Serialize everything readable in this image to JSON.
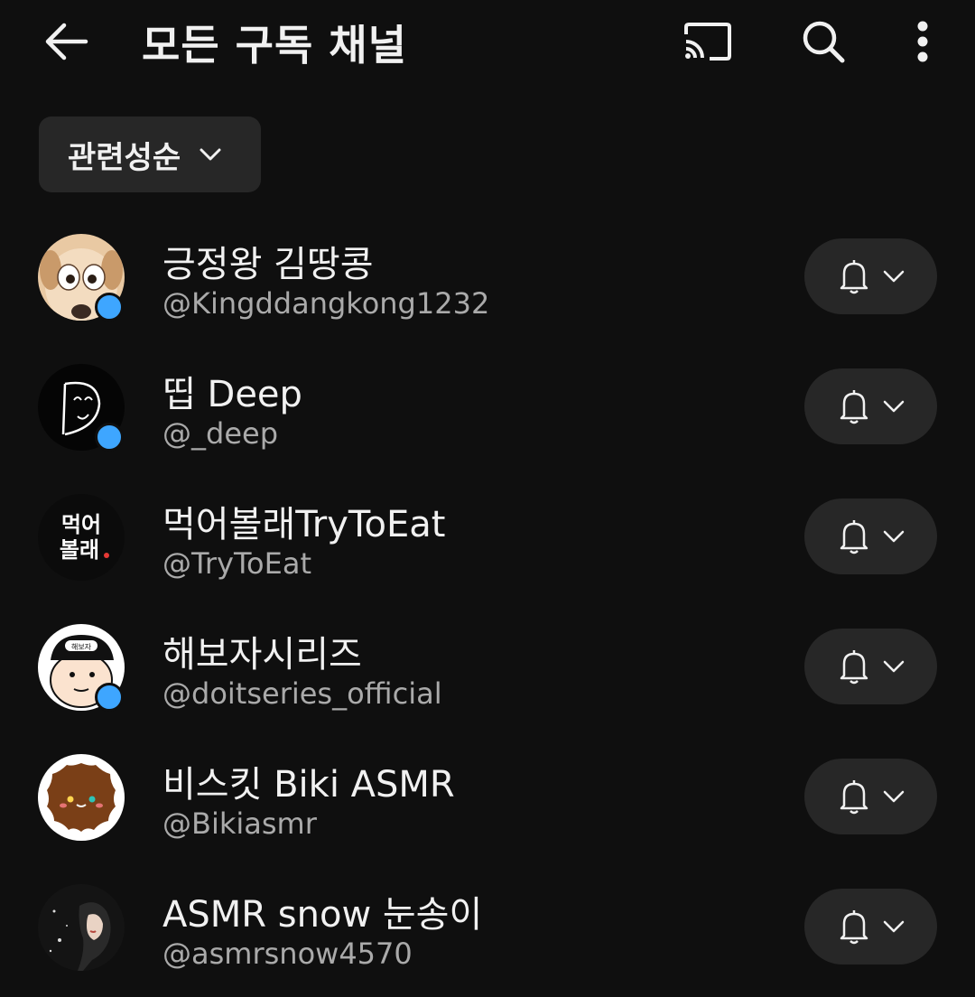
{
  "header": {
    "title": "모든 구독 채널",
    "icons": [
      "back-arrow-icon",
      "cast-icon",
      "search-icon",
      "more-vertical-icon"
    ]
  },
  "sort": {
    "label": "관련성순"
  },
  "colors": {
    "background": "#0f0f0f",
    "surface": "#272727",
    "accent": "#3ea6ff",
    "secondary_text": "#aaaaaa"
  },
  "channels": [
    {
      "name": "긍정왕 김땅콩",
      "handle": "@Kingddangkong1232",
      "new_content": true
    },
    {
      "name": "띱 Deep",
      "handle": "@_deep",
      "new_content": true
    },
    {
      "name": "먹어볼래TryToEat",
      "handle": "@TryToEat",
      "new_content": false,
      "avatar_text": [
        "먹어",
        "볼래"
      ]
    },
    {
      "name": "해보자시리즈",
      "handle": "@doitseries_official",
      "new_content": true,
      "avatar_text": [
        "해보자"
      ]
    },
    {
      "name": "비스킷 Biki ASMR",
      "handle": "@Bikiasmr",
      "new_content": false
    },
    {
      "name": "ASMR snow 눈송이",
      "handle": "@asmrsnow4570",
      "new_content": false
    }
  ]
}
